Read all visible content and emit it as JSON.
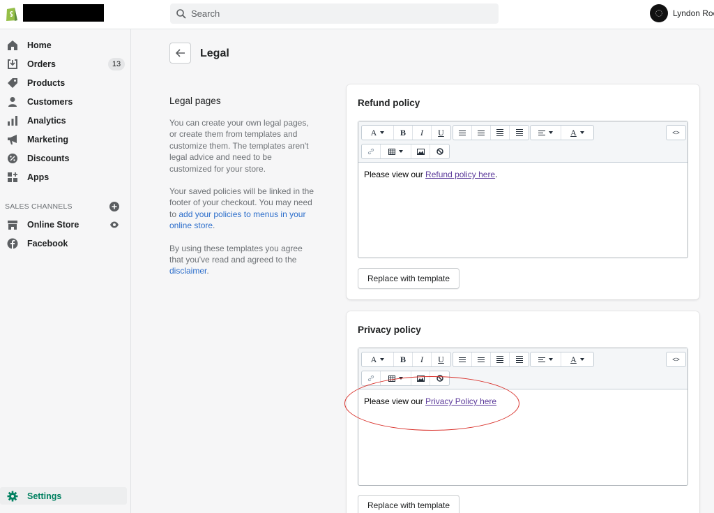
{
  "topbar": {
    "search_placeholder": "Search",
    "user_name": "Lyndon Roe"
  },
  "sidebar": {
    "items": [
      {
        "label": "Home",
        "icon": "home-icon"
      },
      {
        "label": "Orders",
        "icon": "orders-icon",
        "badge": "13"
      },
      {
        "label": "Products",
        "icon": "tag-icon"
      },
      {
        "label": "Customers",
        "icon": "person-icon"
      },
      {
        "label": "Analytics",
        "icon": "bar-chart-icon"
      },
      {
        "label": "Marketing",
        "icon": "megaphone-icon"
      },
      {
        "label": "Discounts",
        "icon": "discount-icon"
      },
      {
        "label": "Apps",
        "icon": "apps-icon"
      }
    ],
    "sales_channels_title": "SALES CHANNELS",
    "channels": [
      {
        "label": "Online Store",
        "icon": "store-icon"
      },
      {
        "label": "Facebook",
        "icon": "facebook-icon"
      }
    ],
    "settings_label": "Settings"
  },
  "header": {
    "title": "Legal"
  },
  "description": {
    "heading": "Legal pages",
    "p1": "You can create your own legal pages, or create them from templates and customize them. The templates aren't legal advice and need to be customized for your store.",
    "p2_pre": "Your saved policies will be linked in the footer of your checkout. You may need to ",
    "p2_link": "add your policies to menus in your online store",
    "p2_post": ".",
    "p3_pre": "By using these templates you agree that you've read and agreed to the ",
    "p3_link": "disclaimer",
    "p3_post": "."
  },
  "refund": {
    "title": "Refund policy",
    "content_pre": "Please view our ",
    "content_link": "Refund policy here",
    "content_post": ".",
    "replace_label": "Replace with template"
  },
  "privacy": {
    "title": "Privacy policy",
    "content_pre": "Please view our ",
    "content_link": "Privacy Policy here",
    "content_post": "",
    "replace_label": "Replace with template"
  },
  "toolbar": {
    "font": "A",
    "bold": "B",
    "italic": "I",
    "underline": "U",
    "color": "A",
    "source": "<>"
  },
  "colors": {
    "accent": "#008060",
    "link": "#2c6ecb",
    "annotation": "#d9312b"
  }
}
